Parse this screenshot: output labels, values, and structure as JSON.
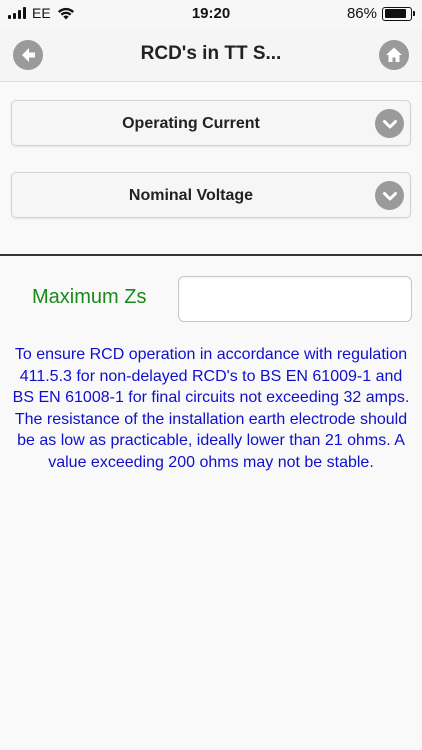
{
  "status_bar": {
    "carrier": "EE",
    "time": "19:20",
    "battery_percent_text": "86%",
    "battery_level": 0.86
  },
  "header": {
    "title": "RCD's in TT S...",
    "back_icon": "back-arrow-icon",
    "home_icon": "home-icon"
  },
  "selects": [
    {
      "label": "Operating Current",
      "icon": "chevron-down-icon"
    },
    {
      "label": "Nominal Voltage",
      "icon": "chevron-down-icon"
    }
  ],
  "result": {
    "label": "Maximum Zs",
    "value": ""
  },
  "info_text": "To ensure RCD operation in accordance with regulation 411.5.3 for non-delayed RCD's to BS EN 61009-1 and BS EN 61008-1 for final circuits not exceeding 32 amps. The resistance of the installation earth electrode should be as low as practicable, ideally lower than 21 ohms. A value exceeding 200 ohms may not be stable.",
  "colors": {
    "label_green": "#1a8a1a",
    "info_blue": "#1010cc",
    "icon_gray": "#9a9a9a"
  }
}
